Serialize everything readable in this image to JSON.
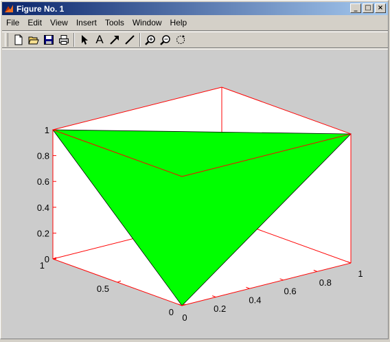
{
  "window": {
    "title": "Figure No. 1",
    "buttons": [
      "_",
      "□",
      "×"
    ]
  },
  "menu": [
    "File",
    "Edit",
    "View",
    "Insert",
    "Tools",
    "Window",
    "Help"
  ],
  "toolbar": {
    "icons": [
      "new-file-icon",
      "open-folder-icon",
      "save-icon",
      "print-icon",
      "select-arrow-icon",
      "text-icon",
      "arrow-tool-icon",
      "line-tool-icon",
      "zoom-in-icon",
      "zoom-out-icon",
      "rotate-3d-icon"
    ],
    "text_tool_label": "A"
  },
  "colors": {
    "axes_box": "#ff0000",
    "patch_fill": "#00ff00",
    "figure_bg": "#cccccc",
    "axes_bg": "#ffffff"
  },
  "chart_data": {
    "type": "3d-patch",
    "z_ticks": [
      "0",
      "0.2",
      "0.4",
      "0.6",
      "0.8",
      "1"
    ],
    "x_ticks": [
      "0",
      "0.2",
      "0.4",
      "0.6",
      "0.8",
      "1"
    ],
    "y_ticks": [
      "0",
      "0.5",
      "1"
    ],
    "xlim": [
      0,
      1
    ],
    "ylim": [
      0,
      1
    ],
    "zlim": [
      0,
      1
    ],
    "patch": {
      "vertices": [
        [
          0,
          1,
          1
        ],
        [
          1,
          0,
          1
        ],
        [
          0,
          0,
          0
        ]
      ],
      "color": "#00ff00"
    }
  }
}
